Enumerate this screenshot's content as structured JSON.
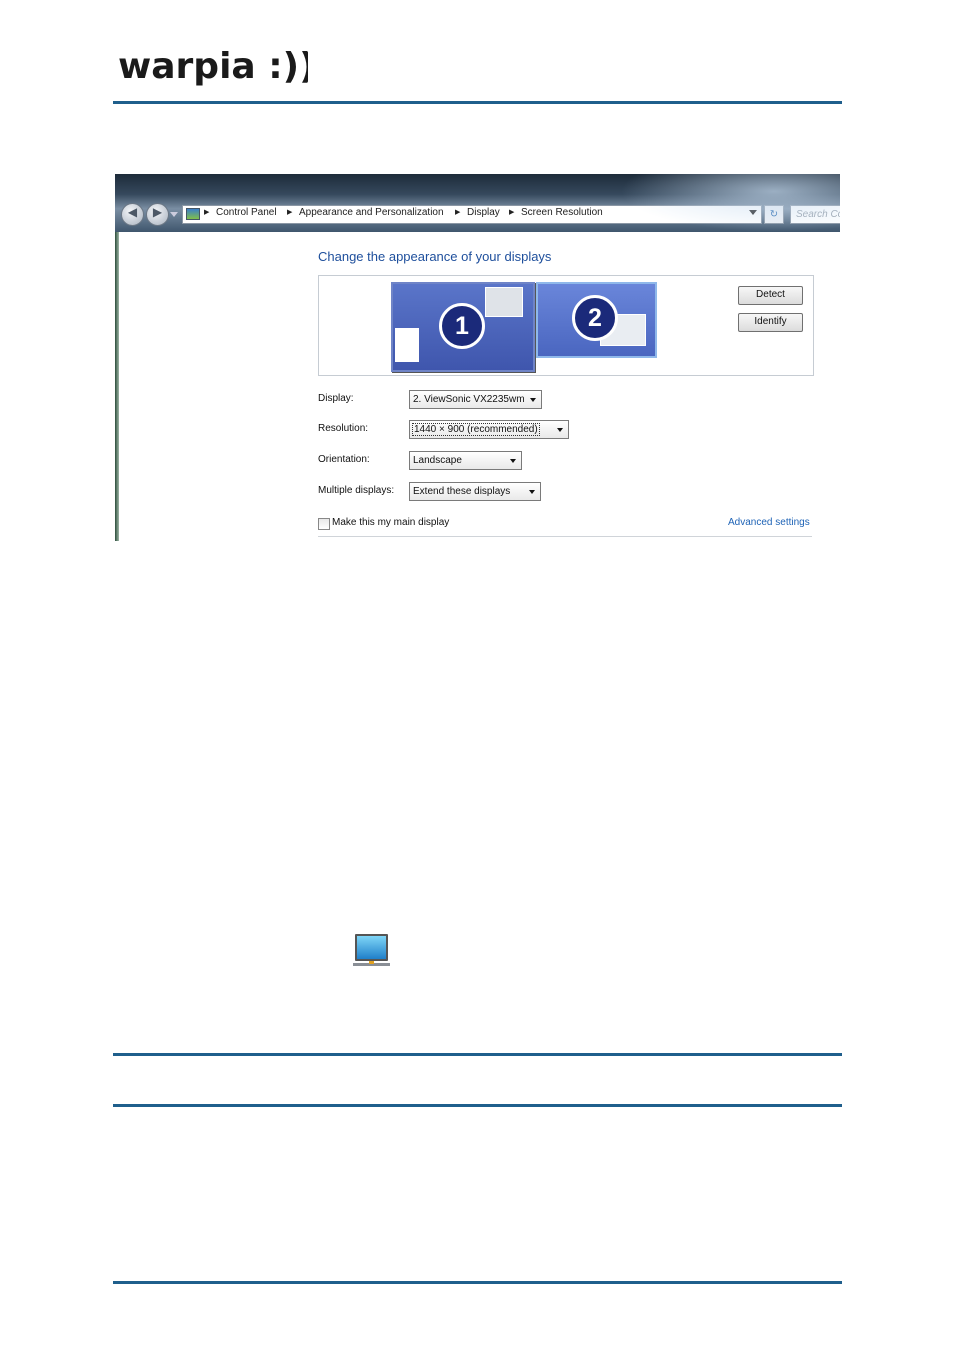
{
  "logo": {
    "text": "warpia :)))"
  },
  "window": {
    "breadcrumb": [
      "Control Panel",
      "Appearance and Personalization",
      "Display",
      "Screen Resolution"
    ],
    "search_placeholder": "Search Co",
    "heading": "Change the appearance of your displays",
    "monitors": [
      {
        "label": "1"
      },
      {
        "label": "2"
      }
    ],
    "buttons": {
      "detect": "Detect",
      "identify": "Identify"
    },
    "fields": {
      "display": {
        "label": "Display:",
        "value": "2. ViewSonic VX2235wm"
      },
      "resolution": {
        "label": "Resolution:",
        "value": "1440 × 900 (recommended)"
      },
      "orientation": {
        "label": "Orientation:",
        "value": "Landscape"
      },
      "multiple_displays": {
        "label": "Multiple displays:",
        "value": "Extend these displays"
      }
    },
    "main_display_checkbox": {
      "label": "Make this my main display",
      "checked": false
    },
    "advanced_link": "Advanced settings"
  },
  "colors": {
    "rule": "#1f5f8c",
    "heading": "#1e4f9c",
    "link": "#1e63b6"
  },
  "icons": [
    "back-arrow-icon",
    "forward-arrow-icon",
    "control-panel-icon",
    "refresh-icon",
    "monitor-icon"
  ]
}
